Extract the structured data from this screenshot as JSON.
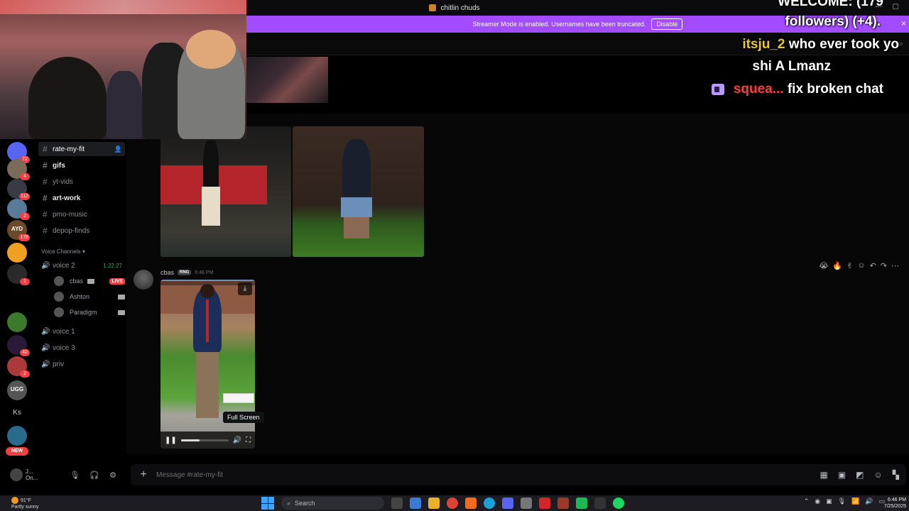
{
  "window": {
    "title": "chitlin chuds"
  },
  "banner": {
    "text": "Streamer Mode is enabled. Usernames have been truncated.",
    "disable_label": "Disable",
    "close": "×"
  },
  "overlay": {
    "welcome_line": "WELCOME: (179",
    "followers_line": "followers) (+4).",
    "msg1_user": "itsju_2",
    "msg1_line1": "who ever took yo",
    "msg1_line2": "shi A Lmanz",
    "msg2_user": "squea...",
    "msg2_text": "fix broken chat"
  },
  "servers": [
    {
      "badge": "72",
      "color": "#5865f2"
    },
    {
      "badge": "4",
      "color": "#7a6a5a"
    },
    {
      "badge": "112",
      "color": "#3a3a44"
    },
    {
      "badge": "2",
      "color": "#5a7a9a"
    },
    {
      "badge": "178",
      "color": "#6a4a2a",
      "label": "AYD"
    },
    {
      "badge": "",
      "color": "#f0a020"
    },
    {
      "badge": "1",
      "color": "#2a2a2a"
    },
    {
      "badge": "",
      "color": "#3a7a2a"
    },
    {
      "badge": "42",
      "color": "#2a1a3a"
    },
    {
      "badge": "2",
      "color": "#aa3a3a"
    },
    {
      "badge": "",
      "color": "#555",
      "label": "UGG"
    },
    {
      "badge": "",
      "color": "#000",
      "label": "Ks"
    },
    {
      "badge": "",
      "color": "#2a6a8a"
    }
  ],
  "new_badge": "NEW",
  "channels": {
    "text": [
      {
        "name": "rate-my-fit",
        "state": "active"
      },
      {
        "name": "gifs",
        "state": "bright"
      },
      {
        "name": "yt-vids",
        "state": "muted"
      },
      {
        "name": "art-work",
        "state": "bright"
      },
      {
        "name": "pmo-music",
        "state": "muted"
      },
      {
        "name": "depop-finds",
        "state": "muted"
      }
    ],
    "voice_section": "Voice Channels",
    "voice": [
      {
        "name": "voice 2",
        "timer": "1:22:27"
      },
      {
        "name": "voice 1"
      },
      {
        "name": "voice 3"
      },
      {
        "name": "priv"
      }
    ],
    "voice_users": [
      {
        "name": "cbas",
        "live": "LIVE"
      },
      {
        "name": "Ashton"
      },
      {
        "name": "Paradigm"
      }
    ]
  },
  "user_panel": {
    "name": "J...",
    "status": "On..."
  },
  "message": {
    "author": "cbas",
    "tag": "RNG",
    "time": "6:46 PM",
    "tooltip": "Full Screen",
    "video_progress_pct": 40
  },
  "reactions": [
    "😭",
    "🔥",
    "✌",
    "☺",
    "↶",
    "↷",
    "⋯"
  ],
  "composer": {
    "placeholder": "Message #rate-my-fit"
  },
  "taskbar": {
    "weather_temp": "91°F",
    "weather_desc": "Partly sunny",
    "search_label": "Search",
    "time": "6:46 PM",
    "date": "7/25/2025"
  }
}
